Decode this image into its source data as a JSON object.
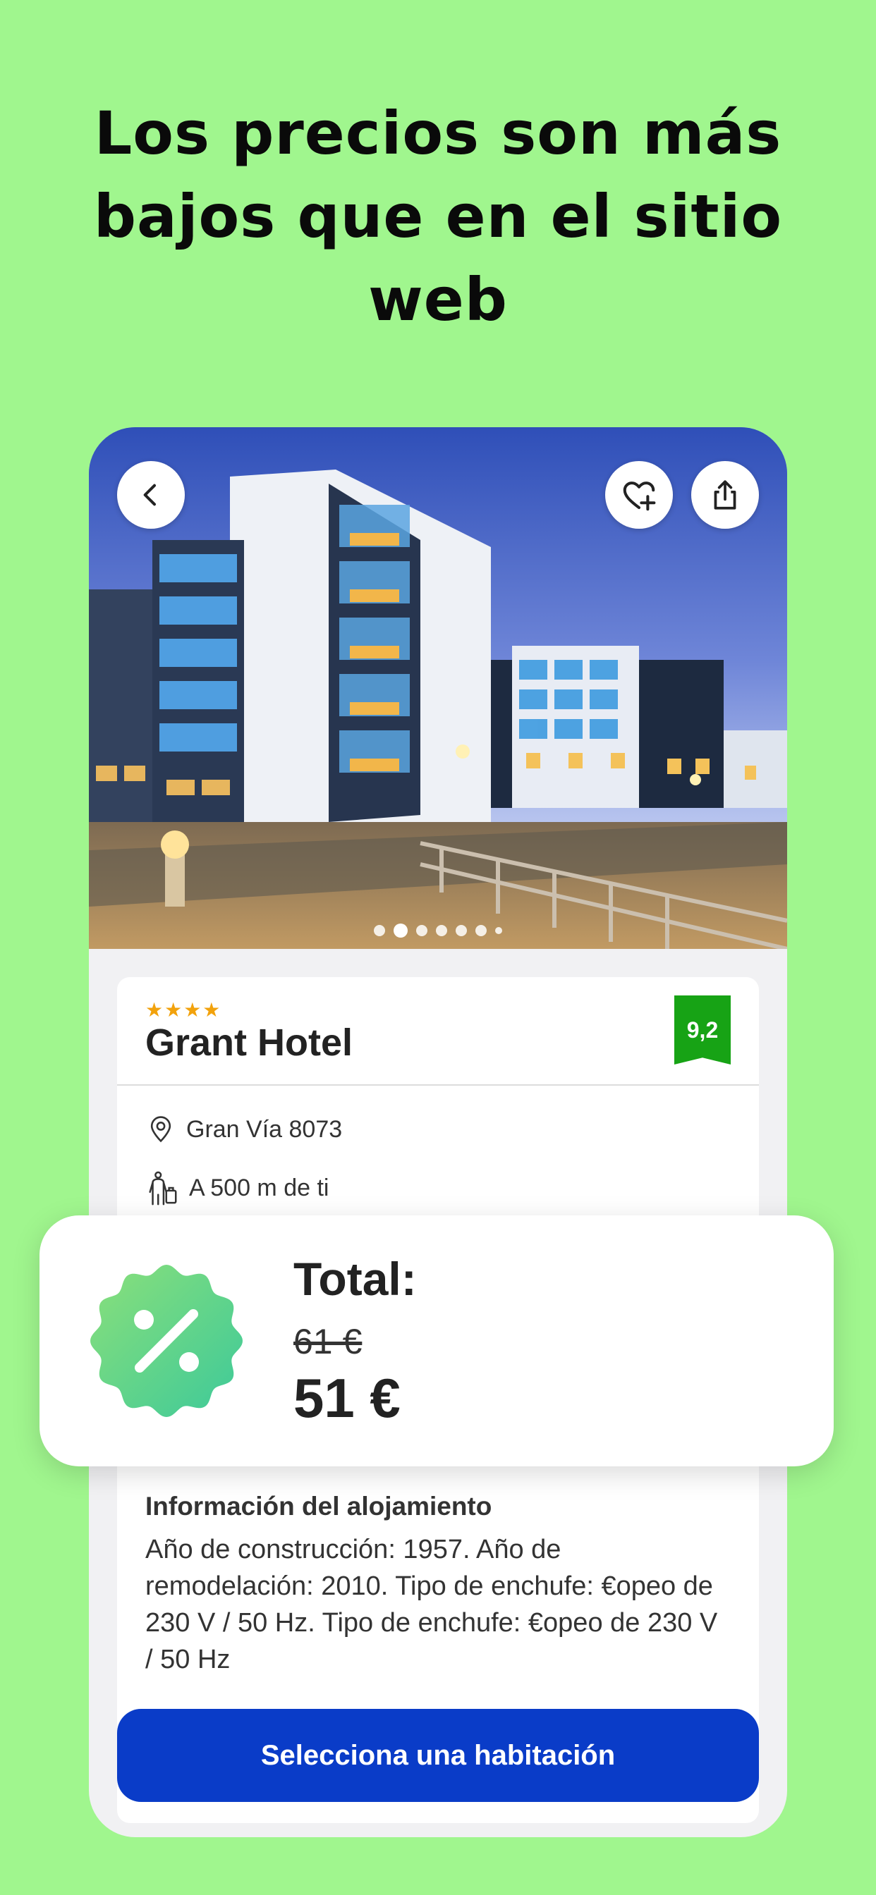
{
  "headline": {
    "line1": "Los precios son más",
    "line2": "bajos que en el sitio",
    "line3": "web"
  },
  "photo": {
    "icons": {
      "back": "chevron-left-icon",
      "favorite": "heart-plus-icon",
      "share": "share-icon"
    },
    "carousel": {
      "count": 7,
      "active_index": 1
    }
  },
  "hotel": {
    "stars": "★★★★",
    "name": "Grant Hotel",
    "rating": "9,2",
    "address": "Gran Vía 8073",
    "distance": "A 500 m de ti"
  },
  "price": {
    "label": "Total:",
    "old": "61 €",
    "new": "51 €"
  },
  "property_info": {
    "title": "Información del alojamiento",
    "text": "Año de construcción: 1957. Año de remodelación: 2010. Tipo de enchufe: €opeo de 230 V / 50 Hz. Tipo de enchufe: €opeo de 230 V / 50 Hz"
  },
  "cta": {
    "label": "Selecciona una habitación"
  },
  "colors": {
    "background": "#a0f68e",
    "cta": "#0a3cc8",
    "rating": "#17a315",
    "stars": "#f2a20c"
  }
}
